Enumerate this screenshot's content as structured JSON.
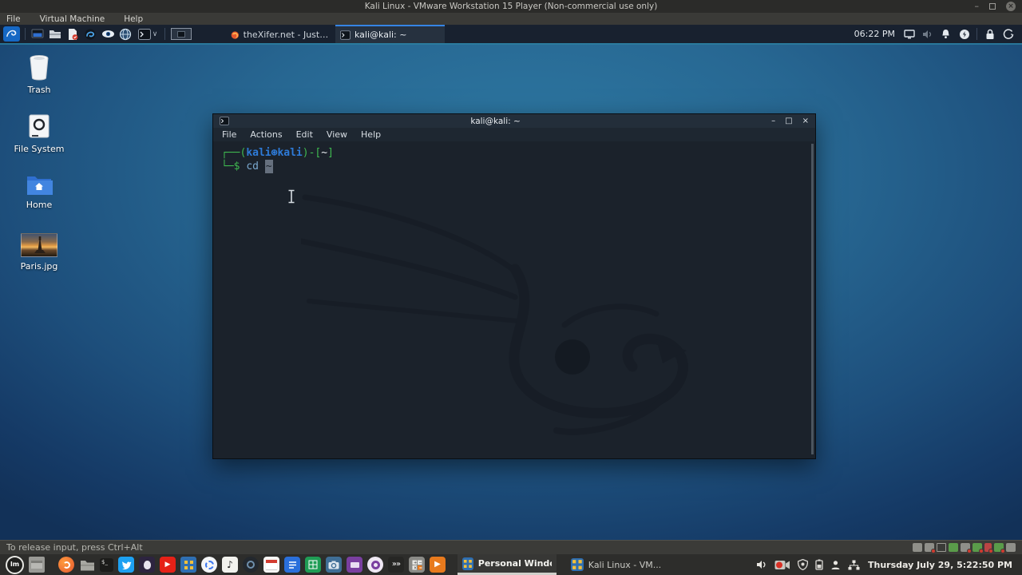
{
  "vmware": {
    "window_title": "Kali Linux - VMware Workstation 15 Player (Non-commercial use only)",
    "menus": [
      "File",
      "Virtual Machine",
      "Help"
    ],
    "window_controls": [
      "minimize",
      "restore",
      "close"
    ],
    "status_bar": {
      "hint": "To release input, press Ctrl+Alt"
    },
    "device_indicators": [
      "hard-disk",
      "cd-dvd",
      "display",
      "network-adapter",
      "network-adapter-2",
      "usb-controller",
      "serial-port",
      "sound-card",
      "shared-folders"
    ]
  },
  "kali_panel": {
    "launcher_icons": [
      "kali-menu",
      "display-settings",
      "file-manager",
      "text-editor",
      "zap-proxy",
      "eye-viewer",
      "web-browser",
      "terminal"
    ],
    "workspace_pager": "workspace-1",
    "window_buttons": [
      {
        "label": "theXifer.net - Just a Web...",
        "app": "firefox",
        "active": false
      },
      {
        "label": "kali@kali: ~",
        "app": "terminal",
        "active": true
      }
    ],
    "clock": "06:22 PM",
    "tray_icons": [
      "display",
      "volume",
      "notifications",
      "power-manager",
      "lock-screen",
      "logout"
    ]
  },
  "desktop_icons": [
    {
      "label": "Trash",
      "icon": "trash-can"
    },
    {
      "label": "File System",
      "icon": "hard-drive"
    },
    {
      "label": "Home",
      "icon": "home-folder"
    },
    {
      "label": "Paris.jpg",
      "icon": "image-thumbnail"
    }
  ],
  "terminal_window": {
    "title": "kali@kali: ~",
    "menus": [
      "File",
      "Actions",
      "Edit",
      "View",
      "Help"
    ],
    "window_controls": [
      "minimize",
      "maximize",
      "close"
    ],
    "prompt": {
      "l1_open": "┌──(",
      "user": "kali",
      "badge": "⊛",
      "host": "kali",
      "l1_mid": ")-[",
      "cwd": "~",
      "l1_close": "]",
      "l2_frame": "└─",
      "dollar": "$",
      "command": "cd",
      "cursor_char": "~"
    },
    "colors": {
      "background": "#1b222b",
      "prompt_frame_green": "#3fb950",
      "user_host_blue": "#2e7bd8",
      "command_blue": "#7aa9d0",
      "cursor_gray": "#66707e"
    }
  },
  "host_taskbar": {
    "app_icons": [
      "mint-menu",
      "show-desktop",
      "firefox",
      "file-manager",
      "terminal",
      "twitter",
      "tor-browser",
      "youtube",
      "vmware-player",
      "signal",
      "music-player",
      "screen-recorder",
      "calendar",
      "writer-document",
      "spreadsheet",
      "camera",
      "media-editor",
      "photo-lens",
      "shell-history",
      "calculator",
      "video-player"
    ],
    "task_buttons": [
      {
        "label": "Personal Windo...",
        "app": "vmware-player",
        "active": true
      },
      {
        "label": "Kali Linux - VM...",
        "app": "vmware-player",
        "active": false
      }
    ],
    "tray_icons": [
      "volume",
      "screen-recorder",
      "shield",
      "battery",
      "user-session",
      "network"
    ],
    "clock": "Thursday July 29, 5:22:50 PM"
  },
  "accent_colors": {
    "kali_active_tab_blue": "#3584e4",
    "wallpaper_blue": "#2e7aa4",
    "panel_dark": "#18212f"
  }
}
